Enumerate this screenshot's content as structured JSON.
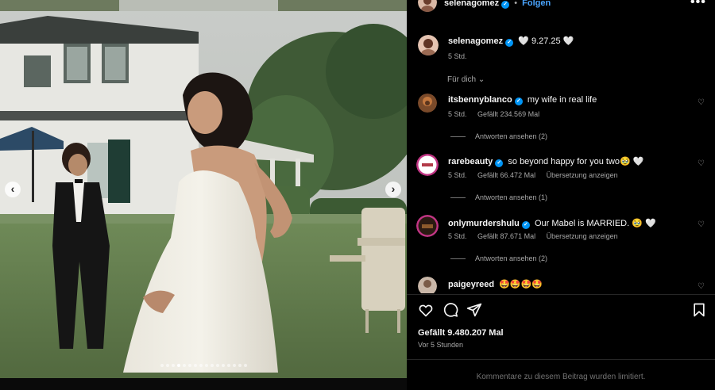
{
  "post": {
    "author": "selenagomez",
    "follow_label": "Folgen",
    "more_label": "•••",
    "caption": "🤍 9.27.25 🤍",
    "caption_time": "5 Std.",
    "likes": "Gefällt 9.480.207 Mal",
    "time_ago": "Vor 5 Stunden",
    "comments_limited": "Kommentare zu diesem Beitrag wurden limitiert.",
    "sort_label": "Für dich"
  },
  "media": {
    "dot_count": 16,
    "active_dot": 3,
    "prev_icon": "‹",
    "next_icon": "›"
  },
  "comments": [
    {
      "username": "itsbennyblanco",
      "verified": true,
      "text": "my wife in real life",
      "time": "5 Std.",
      "likes": "Gefällt 234.569 Mal",
      "translate": "",
      "replies": "Antworten ansehen (2)"
    },
    {
      "username": "rarebeauty",
      "verified": true,
      "text": "so beyond happy for you two🥹 🤍",
      "time": "5 Std.",
      "likes": "Gefällt 66.472 Mal",
      "translate": "Übersetzung anzeigen",
      "replies": "Antworten ansehen (1)"
    },
    {
      "username": "onlymurdershulu",
      "verified": true,
      "text": "Our Mabel is MARRIED. 🥹 🤍",
      "time": "5 Std.",
      "likes": "Gefällt 87.671 Mal",
      "translate": "Übersetzung anzeigen",
      "replies": "Antworten ansehen (2)"
    },
    {
      "username": "paigeyreed",
      "verified": false,
      "text": "🤩🤩🤩🤩",
      "time": "",
      "likes": "",
      "translate": "",
      "replies": ""
    }
  ],
  "icons": {
    "heart": "heart-icon",
    "comment": "comment-icon",
    "share": "share-icon",
    "save": "bookmark-icon",
    "more": "more-icon",
    "sort": "chevron-down-icon"
  },
  "colors": {
    "accent": "#0095f6",
    "follow": "#4aa5ff",
    "secondary_text": "#a8a8a8",
    "background": "#000000"
  }
}
